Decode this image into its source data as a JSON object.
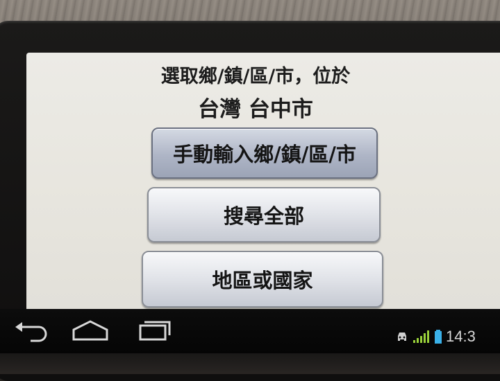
{
  "dialog": {
    "prompt_line1": "選取鄉/鎮/區/市，位於",
    "prompt_line2": "台灣 台中市"
  },
  "buttons": [
    {
      "label": "手動輸入鄉/鎮/區/市",
      "state": "selected"
    },
    {
      "label": "搜尋全部",
      "state": "normal"
    },
    {
      "label": "地區或國家",
      "state": "normal"
    }
  ],
  "navigation_bar": {
    "icons": [
      "back-icon",
      "home-icon",
      "recent-apps-icon"
    ]
  },
  "status_bar": {
    "icons": [
      "car-mode-icon",
      "signal-icon",
      "battery-icon"
    ],
    "time": "14:3",
    "colors": {
      "signal": "#9ad23a",
      "battery": "#3ab0e8"
    }
  }
}
